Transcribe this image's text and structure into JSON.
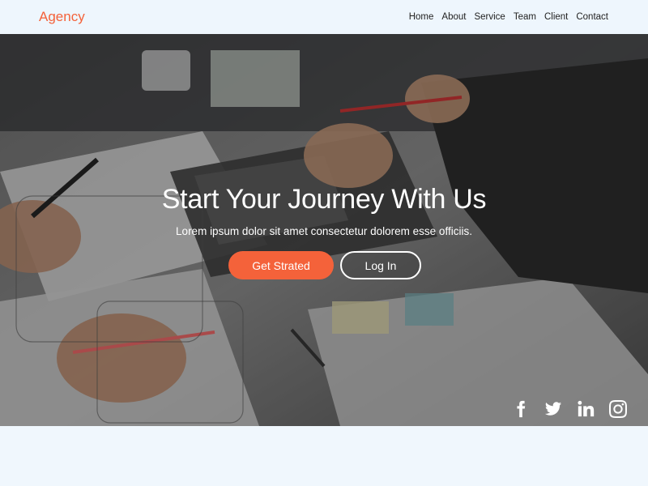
{
  "navbar": {
    "brand": "Agency",
    "links": [
      "Home",
      "About",
      "Service",
      "Team",
      "Client",
      "Contact"
    ]
  },
  "hero": {
    "title": "Start Your Journey With Us",
    "subtitle": "Lorem ipsum dolor sit amet consectetur dolorem esse officiis.",
    "primary_button": "Get Strated",
    "secondary_button": "Log In",
    "social_icons": [
      "facebook-icon",
      "twitter-icon",
      "linkedin-icon",
      "instagram-icon"
    ]
  },
  "colors": {
    "accent": "#f4623a",
    "navbar_bg": "#eef6fd",
    "page_bg": "#f0f7fd"
  }
}
